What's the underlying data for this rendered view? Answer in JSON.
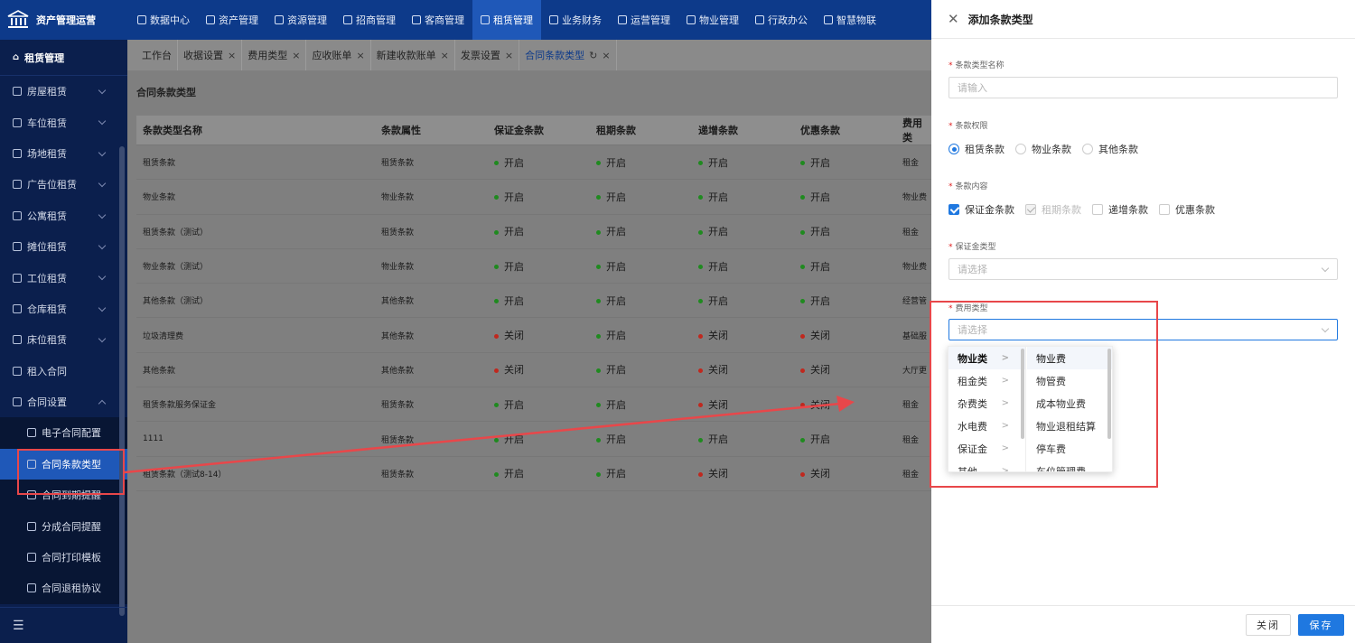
{
  "app": {
    "title": "资产管理运营"
  },
  "topnav": [
    {
      "label": "数据中心",
      "active": false
    },
    {
      "label": "资产管理",
      "active": false
    },
    {
      "label": "资源管理",
      "active": false
    },
    {
      "label": "招商管理",
      "active": false
    },
    {
      "label": "客商管理",
      "active": false
    },
    {
      "label": "租赁管理",
      "active": true
    },
    {
      "label": "业务财务",
      "active": false
    },
    {
      "label": "运营管理",
      "active": false
    },
    {
      "label": "物业管理",
      "active": false
    },
    {
      "label": "行政办公",
      "active": false
    },
    {
      "label": "智慧物联",
      "active": false
    }
  ],
  "sidebar": {
    "header": "租赁管理",
    "items": [
      {
        "label": "房屋租赁",
        "expandable": true
      },
      {
        "label": "车位租赁",
        "expandable": true
      },
      {
        "label": "场地租赁",
        "expandable": true
      },
      {
        "label": "广告位租赁",
        "expandable": true
      },
      {
        "label": "公寓租赁",
        "expandable": true
      },
      {
        "label": "摊位租赁",
        "expandable": true
      },
      {
        "label": "工位租赁",
        "expandable": true
      },
      {
        "label": "仓库租赁",
        "expandable": true
      },
      {
        "label": "床位租赁",
        "expandable": true
      },
      {
        "label": "租入合同",
        "expandable": false
      },
      {
        "label": "合同设置",
        "expandable": true,
        "expanded": true
      }
    ],
    "subitems": [
      {
        "label": "电子合同配置",
        "active": false
      },
      {
        "label": "合同条款类型",
        "active": true
      },
      {
        "label": "合同到期提醒",
        "active": false
      },
      {
        "label": "分成合同提醒",
        "active": false
      },
      {
        "label": "合同打印模板",
        "active": false
      },
      {
        "label": "合同退租协议",
        "active": false
      }
    ]
  },
  "tabs": [
    {
      "label": "工作台",
      "closable": false,
      "active": false
    },
    {
      "label": "收据设置",
      "closable": true,
      "active": false
    },
    {
      "label": "费用类型",
      "closable": true,
      "active": false
    },
    {
      "label": "应收账单",
      "closable": true,
      "active": false
    },
    {
      "label": "新建收款账单",
      "closable": true,
      "active": false
    },
    {
      "label": "发票设置",
      "closable": true,
      "active": false
    },
    {
      "label": "合同条款类型",
      "closable": true,
      "active": true
    }
  ],
  "page": {
    "title": "合同条款类型"
  },
  "table": {
    "columns": [
      "条款类型名称",
      "条款属性",
      "保证金条款",
      "租期条款",
      "递增条款",
      "优惠条款",
      "费用类"
    ],
    "rows": [
      {
        "name": "租赁条款",
        "attr": "租赁条款",
        "deposit": "开启",
        "term": "开启",
        "increase": "开启",
        "discount": "开启",
        "fee": "租金"
      },
      {
        "name": "物业条款",
        "attr": "物业条款",
        "deposit": "开启",
        "term": "开启",
        "increase": "开启",
        "discount": "开启",
        "fee": "物业费"
      },
      {
        "name": "租赁条款（测试）",
        "attr": "租赁条款",
        "deposit": "开启",
        "term": "开启",
        "increase": "开启",
        "discount": "开启",
        "fee": "租金"
      },
      {
        "name": "物业条款（测试）",
        "attr": "物业条款",
        "deposit": "开启",
        "term": "开启",
        "increase": "开启",
        "discount": "开启",
        "fee": "物业费"
      },
      {
        "name": "其他条款（测试）",
        "attr": "其他条款",
        "deposit": "开启",
        "term": "开启",
        "increase": "开启",
        "discount": "开启",
        "fee": "经营管"
      },
      {
        "name": "垃圾清理费",
        "attr": "其他条款",
        "deposit": "关闭",
        "term": "开启",
        "increase": "关闭",
        "discount": "关闭",
        "fee": "基础服"
      },
      {
        "name": "其他条款",
        "attr": "其他条款",
        "deposit": "关闭",
        "term": "开启",
        "increase": "关闭",
        "discount": "关闭",
        "fee": "大厅更"
      },
      {
        "name": "租赁条款服务保证金",
        "attr": "租赁条款",
        "deposit": "开启",
        "term": "开启",
        "increase": "关闭",
        "discount": "关闭",
        "fee": "租金"
      },
      {
        "name": "1111",
        "attr": "租赁条款",
        "deposit": "开启",
        "term": "开启",
        "increase": "开启",
        "discount": "开启",
        "fee": "租金"
      },
      {
        "name": "租赁条款（测试8-14）",
        "attr": "租赁条款",
        "deposit": "开启",
        "term": "开启",
        "increase": "关闭",
        "discount": "关闭",
        "fee": "租金"
      }
    ]
  },
  "drawer": {
    "title": "添加条款类型",
    "fields": {
      "name": {
        "label": "条款类型名称",
        "placeholder": "请输入"
      },
      "scope": {
        "label": "条款权限",
        "options": [
          "租赁条款",
          "物业条款",
          "其他条款"
        ],
        "selected": "租赁条款"
      },
      "content": {
        "label": "条款内容",
        "options": [
          {
            "label": "保证金条款",
            "checked": true,
            "disabled": false
          },
          {
            "label": "租期条款",
            "checked": true,
            "disabled": true
          },
          {
            "label": "递增条款",
            "checked": false,
            "disabled": false
          },
          {
            "label": "优惠条款",
            "checked": false,
            "disabled": false
          }
        ]
      },
      "deposit_type": {
        "label": "保证金类型",
        "placeholder": "请选择"
      },
      "fee_type": {
        "label": "费用类型",
        "placeholder": "请选择"
      }
    },
    "cascader": {
      "level1": [
        "物业类",
        "租金类",
        "杂费类",
        "水电费",
        "保证金",
        "其他"
      ],
      "level1_selected": "物业类",
      "level2": [
        "物业费",
        "物管费",
        "成本物业费",
        "物业退租结算",
        "停车费",
        "车位管理费"
      ]
    },
    "buttons": {
      "close": "关闭",
      "save": "保存"
    }
  },
  "colors": {
    "primary": "#1f78e0",
    "nav_bg": "#0d3a8a",
    "sidebar_bg": "#0b1f4d",
    "status_on": "#1f8a1f",
    "status_off": "#c0281e",
    "annotation": "#e8474a"
  },
  "icons": {
    "close": "close-icon",
    "chevron": "chevron-down-icon",
    "refresh": "refresh-icon",
    "menu": "menu-icon"
  }
}
